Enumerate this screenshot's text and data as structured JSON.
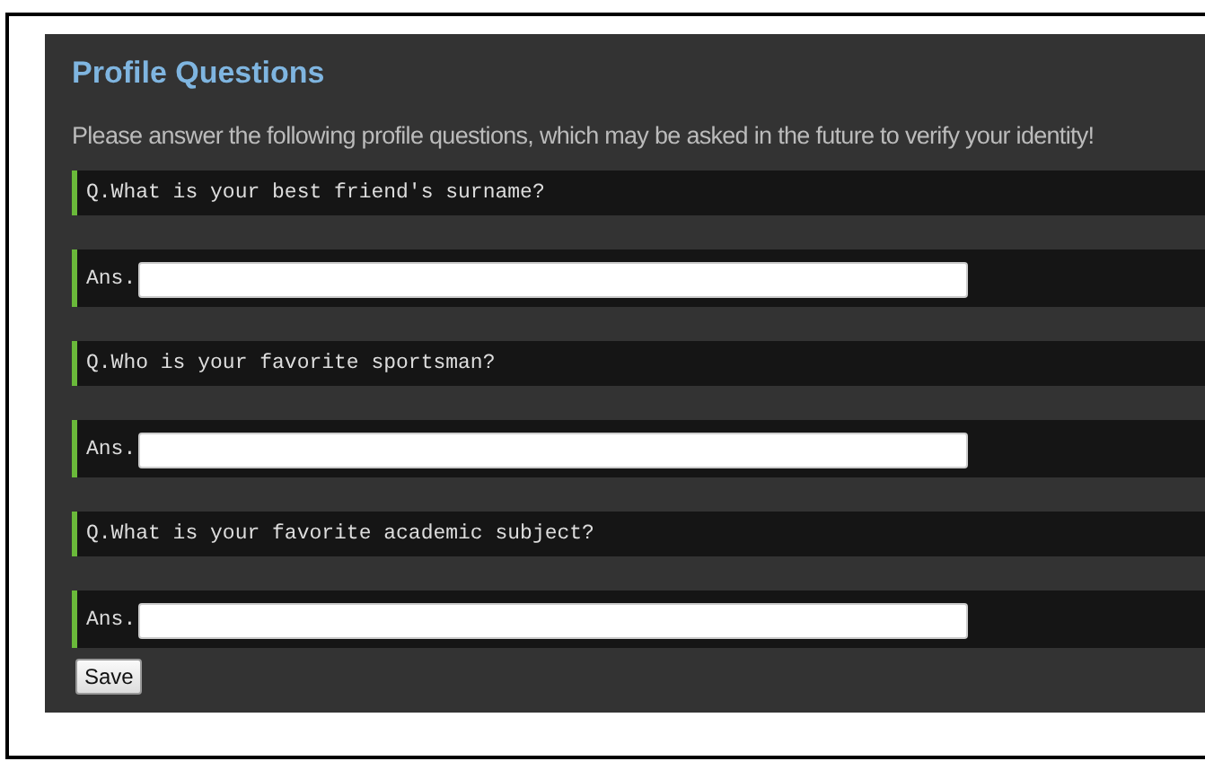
{
  "title": "Profile Questions",
  "description": "Please answer the following profile questions, which may be asked in the future to verify your identity!",
  "questions": [
    {
      "question": "Q.What is your best friend's surname?",
      "answer_label": "Ans."
    },
    {
      "question": "Q.Who is your favorite sportsman?",
      "answer_label": "Ans."
    },
    {
      "question": "Q.What is your favorite academic subject?",
      "answer_label": "Ans."
    }
  ],
  "save_button": "Save"
}
